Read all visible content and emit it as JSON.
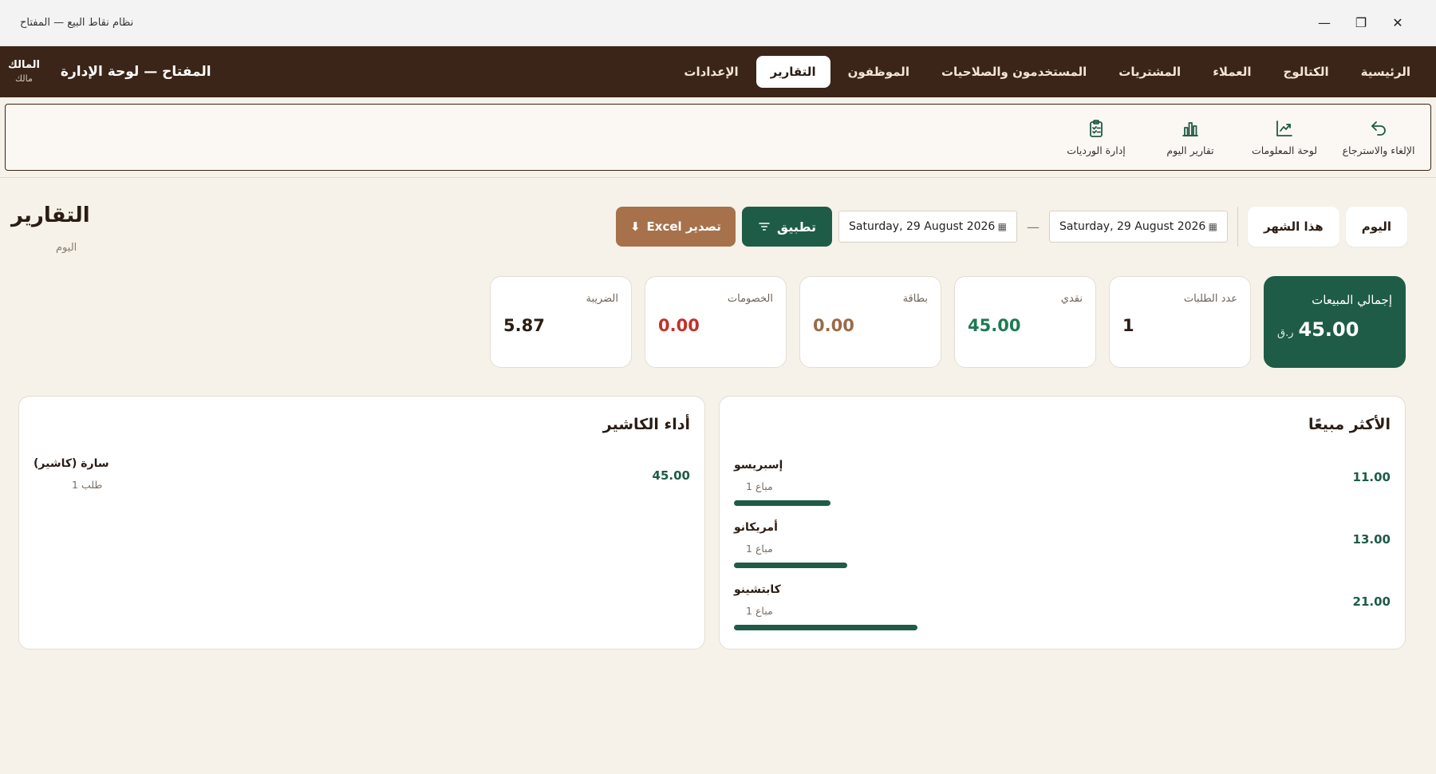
{
  "window": {
    "title": "نظام نقاط البيع — المفتاح",
    "controls": {
      "minimize": "—",
      "restore": "❐",
      "close": "✕"
    }
  },
  "header": {
    "brand_title": "المفتاح — لوحة الإدارة",
    "user_name": "المالك",
    "user_role": "مالك",
    "nav": [
      {
        "label": "الرئيسية",
        "active": false
      },
      {
        "label": "الكتالوج",
        "active": false
      },
      {
        "label": "العملاء",
        "active": false
      },
      {
        "label": "المشتريات",
        "active": false
      },
      {
        "label": "المستخدمون والصلاحيات",
        "active": false
      },
      {
        "label": "الموظفون",
        "active": false
      },
      {
        "label": "التقارير",
        "active": true
      },
      {
        "label": "الإعدادات",
        "active": false
      }
    ]
  },
  "quickbar": [
    {
      "label": "الإلغاء والاسترجاع",
      "icon": "undo-icon"
    },
    {
      "label": "لوحة المعلومات",
      "icon": "trend-chart-icon"
    },
    {
      "label": "تقارير اليوم",
      "icon": "bar-chart-icon"
    },
    {
      "label": "إدارة الورديات",
      "icon": "clipboard-list-icon"
    }
  ],
  "page": {
    "title": "التقارير",
    "subtitle": "اليوم"
  },
  "filters": {
    "today": "اليوم",
    "this_month": "هذا الشهر",
    "date_from": "Saturday, 29 August 2026",
    "date_to": "Saturday, 29 August 2026",
    "separator": "—",
    "apply": "تطبيق",
    "export": "تصدير Excel"
  },
  "stats": {
    "total_sales": {
      "label": "إجمالي المبيعات",
      "value": "45.00",
      "currency": "ر.ق"
    },
    "orders": {
      "label": "عدد الطلبات",
      "value": "1"
    },
    "cash": {
      "label": "نقدي",
      "value": "45.00"
    },
    "card": {
      "label": "بطاقة",
      "value": "0.00"
    },
    "discounts": {
      "label": "الخصومات",
      "value": "0.00"
    },
    "tax": {
      "label": "الضريبة",
      "value": "5.87"
    }
  },
  "top_selling": {
    "title": "الأكثر مبيعًا",
    "items": [
      {
        "name": "إسبريسو",
        "qty": "1 مباع",
        "value": "11.00",
        "share": 0.524
      },
      {
        "name": "أمريكانو",
        "qty": "1 مباع",
        "value": "13.00",
        "share": 0.619
      },
      {
        "name": "كابتشينو",
        "qty": "1 مباع",
        "value": "21.00",
        "share": 1.0
      }
    ]
  },
  "cashier_performance": {
    "title": "أداء الكاشير",
    "items": [
      {
        "name": "سارة (كاشير)",
        "orders": "1 طلب",
        "value": "45.00"
      }
    ]
  },
  "colors": {
    "header_bg": "#3b2418",
    "primary_green": "#1e5c47",
    "export_brown": "#a7714b",
    "page_bg": "#f6f2ea"
  }
}
